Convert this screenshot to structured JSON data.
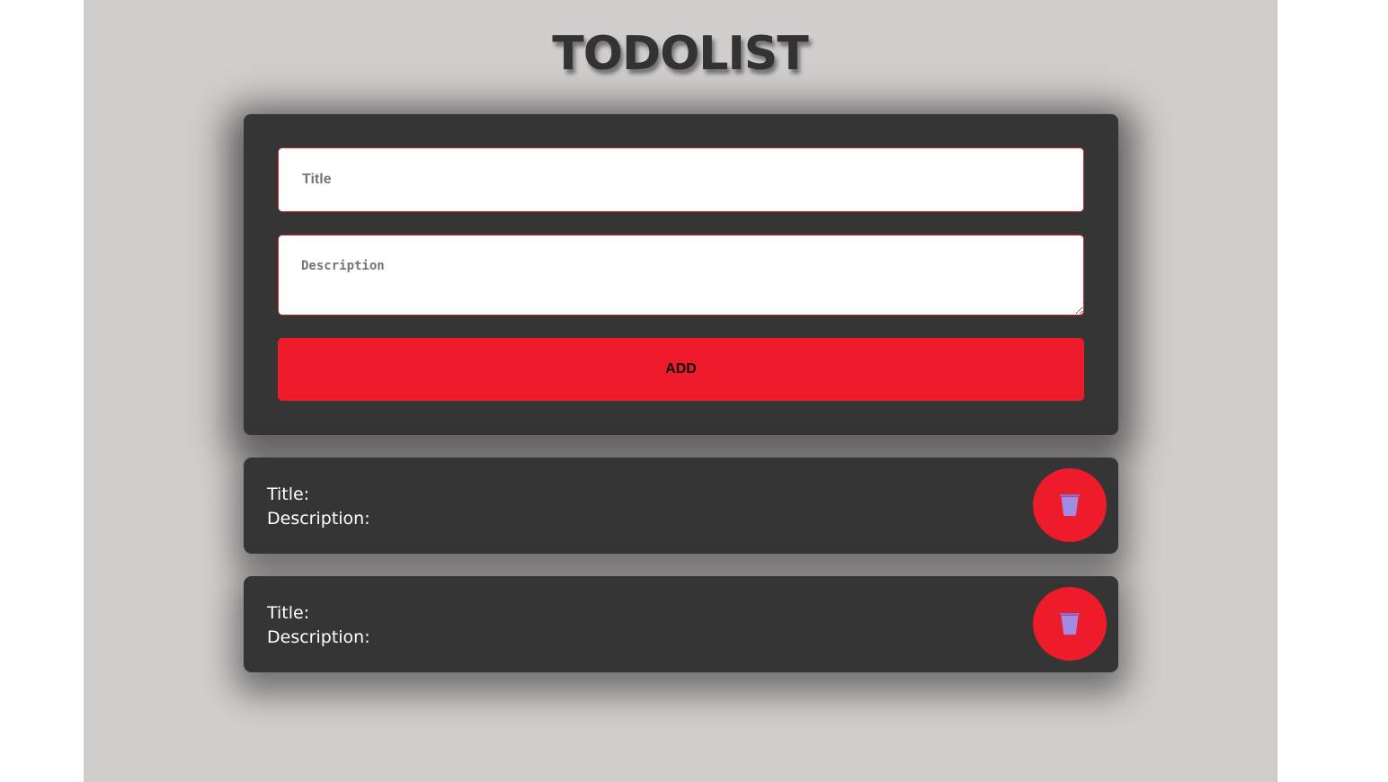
{
  "app": {
    "title": "TODOLIST"
  },
  "form": {
    "title_placeholder": "Title",
    "description_placeholder": "Description",
    "add_label": "ADD"
  },
  "todos": [
    {
      "title_label": "Title:",
      "description_label": "Description:",
      "delete_icon": "trash-icon"
    },
    {
      "title_label": "Title:",
      "description_label": "Description:",
      "delete_icon": "trash-icon"
    }
  ],
  "colors": {
    "page_background": "#d0cdcc",
    "card_background": "#353535",
    "accent_red": "#ee1b2a",
    "icon_purple": "#a28be3",
    "title_text": "#333333"
  }
}
